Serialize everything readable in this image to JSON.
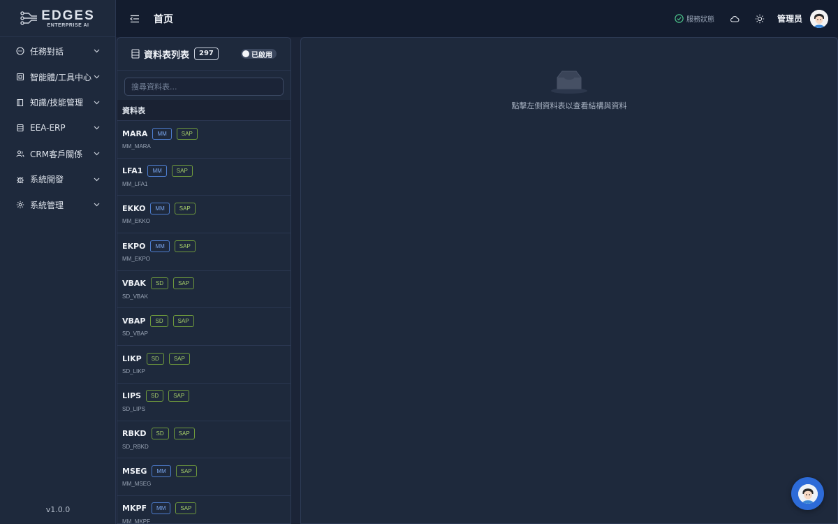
{
  "brand": {
    "main": "EDGES",
    "sub": "ENTERPRISE AI"
  },
  "sidebar": {
    "items": [
      {
        "label": "任務對話",
        "icon": "chat-icon"
      },
      {
        "label": "智能體/工具中心",
        "icon": "agent-icon"
      },
      {
        "label": "知識/技能管理",
        "icon": "book-icon"
      },
      {
        "label": "EEA-ERP",
        "icon": "database-icon"
      },
      {
        "label": "CRM客戶關係",
        "icon": "users-icon"
      },
      {
        "label": "系統開發",
        "icon": "bug-icon"
      },
      {
        "label": "系統管理",
        "icon": "gear-icon"
      }
    ],
    "version": "v1.0.0"
  },
  "topbar": {
    "title": "首页",
    "status_label": "服務狀態",
    "username": "管理员"
  },
  "table_panel": {
    "title": "資料表列表",
    "count": "297",
    "toggle_label": "已啟用",
    "search_placeholder": "搜尋資料表...",
    "column_header": "資料表",
    "rows": [
      {
        "name": "MARA",
        "module": "MM",
        "system": "SAP",
        "code": "MM_MARA"
      },
      {
        "name": "LFA1",
        "module": "MM",
        "system": "SAP",
        "code": "MM_LFA1"
      },
      {
        "name": "EKKO",
        "module": "MM",
        "system": "SAP",
        "code": "MM_EKKO"
      },
      {
        "name": "EKPO",
        "module": "MM",
        "system": "SAP",
        "code": "MM_EKPO"
      },
      {
        "name": "VBAK",
        "module": "SD",
        "system": "SAP",
        "code": "SD_VBAK"
      },
      {
        "name": "VBAP",
        "module": "SD",
        "system": "SAP",
        "code": "SD_VBAP"
      },
      {
        "name": "LIKP",
        "module": "SD",
        "system": "SAP",
        "code": "SD_LIKP"
      },
      {
        "name": "LIPS",
        "module": "SD",
        "system": "SAP",
        "code": "SD_LIPS"
      },
      {
        "name": "RBKD",
        "module": "SD",
        "system": "SAP",
        "code": "SD_RBKD"
      },
      {
        "name": "MSEG",
        "module": "MM",
        "system": "SAP",
        "code": "MM_MSEG"
      },
      {
        "name": "MKPF",
        "module": "MM",
        "system": "SAP",
        "code": "MM_MKPF"
      }
    ]
  },
  "detail_panel": {
    "empty_text": "點擊左側資料表以查看結構與資料"
  },
  "colors": {
    "accent": "#2d6bd8",
    "status_ok": "#4cc38a",
    "tag_mm": "#7aa6ee",
    "tag_sap": "#a8d06a"
  }
}
